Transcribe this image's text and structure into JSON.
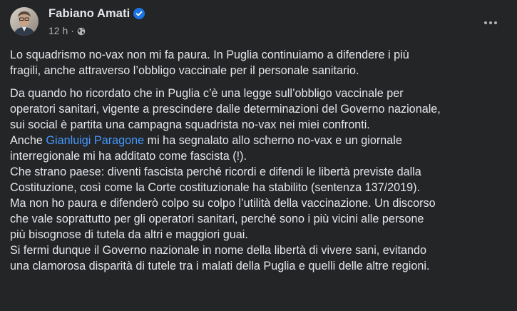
{
  "post": {
    "author": "Fabiano Amati",
    "verified_icon": "verified-badge",
    "time": "12 h",
    "separator": "·",
    "audience_icon": "globe-icon",
    "more_icon": "more-options-icon",
    "colors": {
      "background": "#242526",
      "text": "#e4e6eb",
      "secondary": "#b0b3b8",
      "link": "#4599ff",
      "verified": "#1b74e4"
    },
    "paragraph1": [
      "Lo squadrismo no-vax non mi fa paura. In Puglia continuiamo a difendere i più",
      "fragili, anche attraverso l’obbligo vaccinale per il personale sanitario."
    ],
    "paragraph2": {
      "l1": "Da quando ho ricordato che in Puglia c’è una legge sull’obbligo vaccinale per",
      "l2": "operatori sanitari, vigente a prescindere dalle determinazioni del Governo nazionale,",
      "l3": "sui social è partita una campagna squadrista no-vax nei miei confronti.",
      "l4_prefix": "Anche ",
      "l4_mention": "Gianluigi Paragone",
      "l4_suffix": " mi ha segnalato allo scherno no-vax e un giornale",
      "l5": "interregionale mi ha additato come fascista (!).",
      "l6": "Che strano paese: diventi fascista perché ricordi e difendi le libertà previste dalla",
      "l7": "Costituzione, così come la Corte costituzionale ha stabilito (sentenza 137/2019).",
      "l8": "Ma non ho paura e difenderò colpo su colpo l’utilità della vaccinazione. Un discorso",
      "l9": "che vale soprattutto per gli operatori sanitari, perché sono i più vicini alle persone",
      "l10": "più bisognose di tutela da altri e maggiori guai.",
      "l11": "Si fermi dunque il Governo nazionale in nome della libertà di vivere sani, evitando",
      "l12": "una clamorosa disparità di tutele tra i malati della Puglia e quelli delle altre regioni."
    }
  }
}
